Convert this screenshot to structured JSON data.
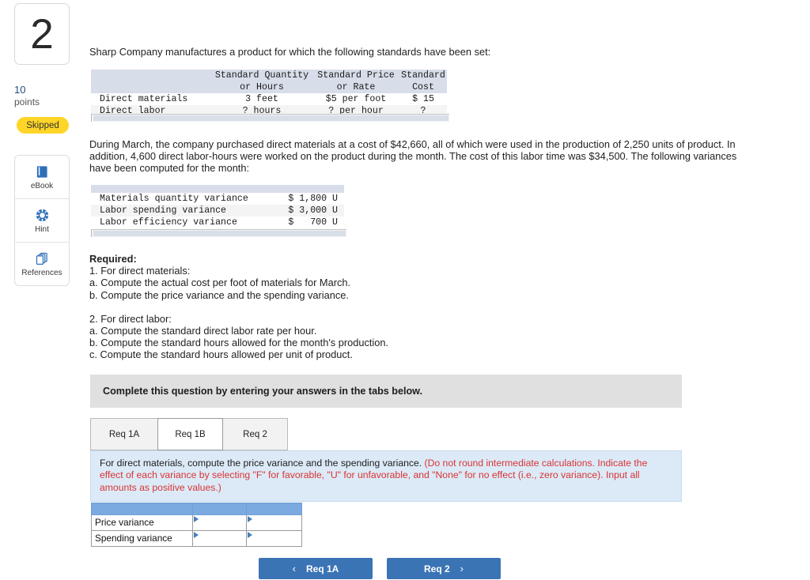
{
  "sidebar": {
    "question_number": "2",
    "points_value": "10",
    "points_label": "points",
    "status_badge": "Skipped",
    "tools": [
      {
        "label": "eBook",
        "icon": "book-icon"
      },
      {
        "label": "Hint",
        "icon": "life-ring-icon"
      },
      {
        "label": "References",
        "icon": "documents-stack-icon"
      }
    ]
  },
  "main": {
    "intro": "Sharp Company manufactures a product for which the following standards have been set:",
    "standards_table": {
      "headers": [
        "",
        "Standard Quantity\n        or Hours",
        "Standard Price\n      or Rate",
        "Standard\n   Cost"
      ],
      "header_line1": [
        "",
        "Standard Quantity",
        "Standard Price",
        "Standard"
      ],
      "header_line2": [
        "",
        "or Hours",
        "or Rate",
        "Cost"
      ],
      "rows": [
        {
          "label": "Direct materials",
          "quantity": "3 feet",
          "price": "$5 per foot",
          "cost": "$ 15"
        },
        {
          "label": "Direct labor",
          "quantity": "? hours",
          "price": "? per hour",
          "cost": "?"
        }
      ]
    },
    "paragraph": "During March, the company purchased direct materials at a cost of $42,660, all of which were used in the production of 2,250 units of product. In addition, 4,600 direct labor-hours were worked on the product during the month. The cost of this labor time was $34,500. The following variances have been computed for the month:",
    "variance_table": {
      "rows": [
        {
          "label": "Materials quantity variance",
          "amount": "$ 1,800 U"
        },
        {
          "label": "Labor spending variance",
          "amount": "$ 3,000 U"
        },
        {
          "label": "Labor efficiency variance",
          "amount": "$   700 U"
        }
      ]
    },
    "required": {
      "title": "Required:",
      "lines_1": [
        "1. For direct materials:",
        "a. Compute the actual cost per foot of materials for March.",
        "b. Compute the price variance and the spending variance."
      ],
      "lines_2": [
        "2. For direct labor:",
        "a. Compute the standard direct labor rate per hour.",
        "b. Compute the standard hours allowed for the month's production.",
        "c. Compute the standard hours allowed per unit of product."
      ]
    }
  },
  "question_panel": {
    "banner": "Complete this question by entering your answers in the tabs below.",
    "tabs": [
      {
        "label": "Req 1A",
        "active": false
      },
      {
        "label": "Req 1B",
        "active": true
      },
      {
        "label": "Req 2",
        "active": false
      }
    ],
    "instruction": {
      "black_part": "For direct materials, compute the price variance and the spending variance. ",
      "red_part": "(Do not round intermediate calculations. Indicate the effect of each variance by selecting \"F\" for favorable, \"U\" for unfavorable, and \"None\" for no effect (i.e., zero variance). Input all amounts as positive values.)"
    },
    "answer_table": {
      "header_cells": [
        "",
        "",
        ""
      ],
      "rows": [
        {
          "label": "Price variance",
          "amount": "",
          "effect": ""
        },
        {
          "label": "Spending variance",
          "amount": "",
          "effect": ""
        }
      ]
    },
    "nav": {
      "prev_label": "Req 1A",
      "prev_icon": "chevron-left-icon",
      "next_label": "Req 2",
      "next_icon": "chevron-right-icon"
    }
  },
  "colors": {
    "accent_blue": "#3b74b5",
    "table_header_blue": "#7baae0",
    "instruction_bg": "#dceaf7",
    "instruction_red": "#d83434",
    "badge_yellow": "#ffd527",
    "mono_header_bg": "#d7dde9"
  }
}
